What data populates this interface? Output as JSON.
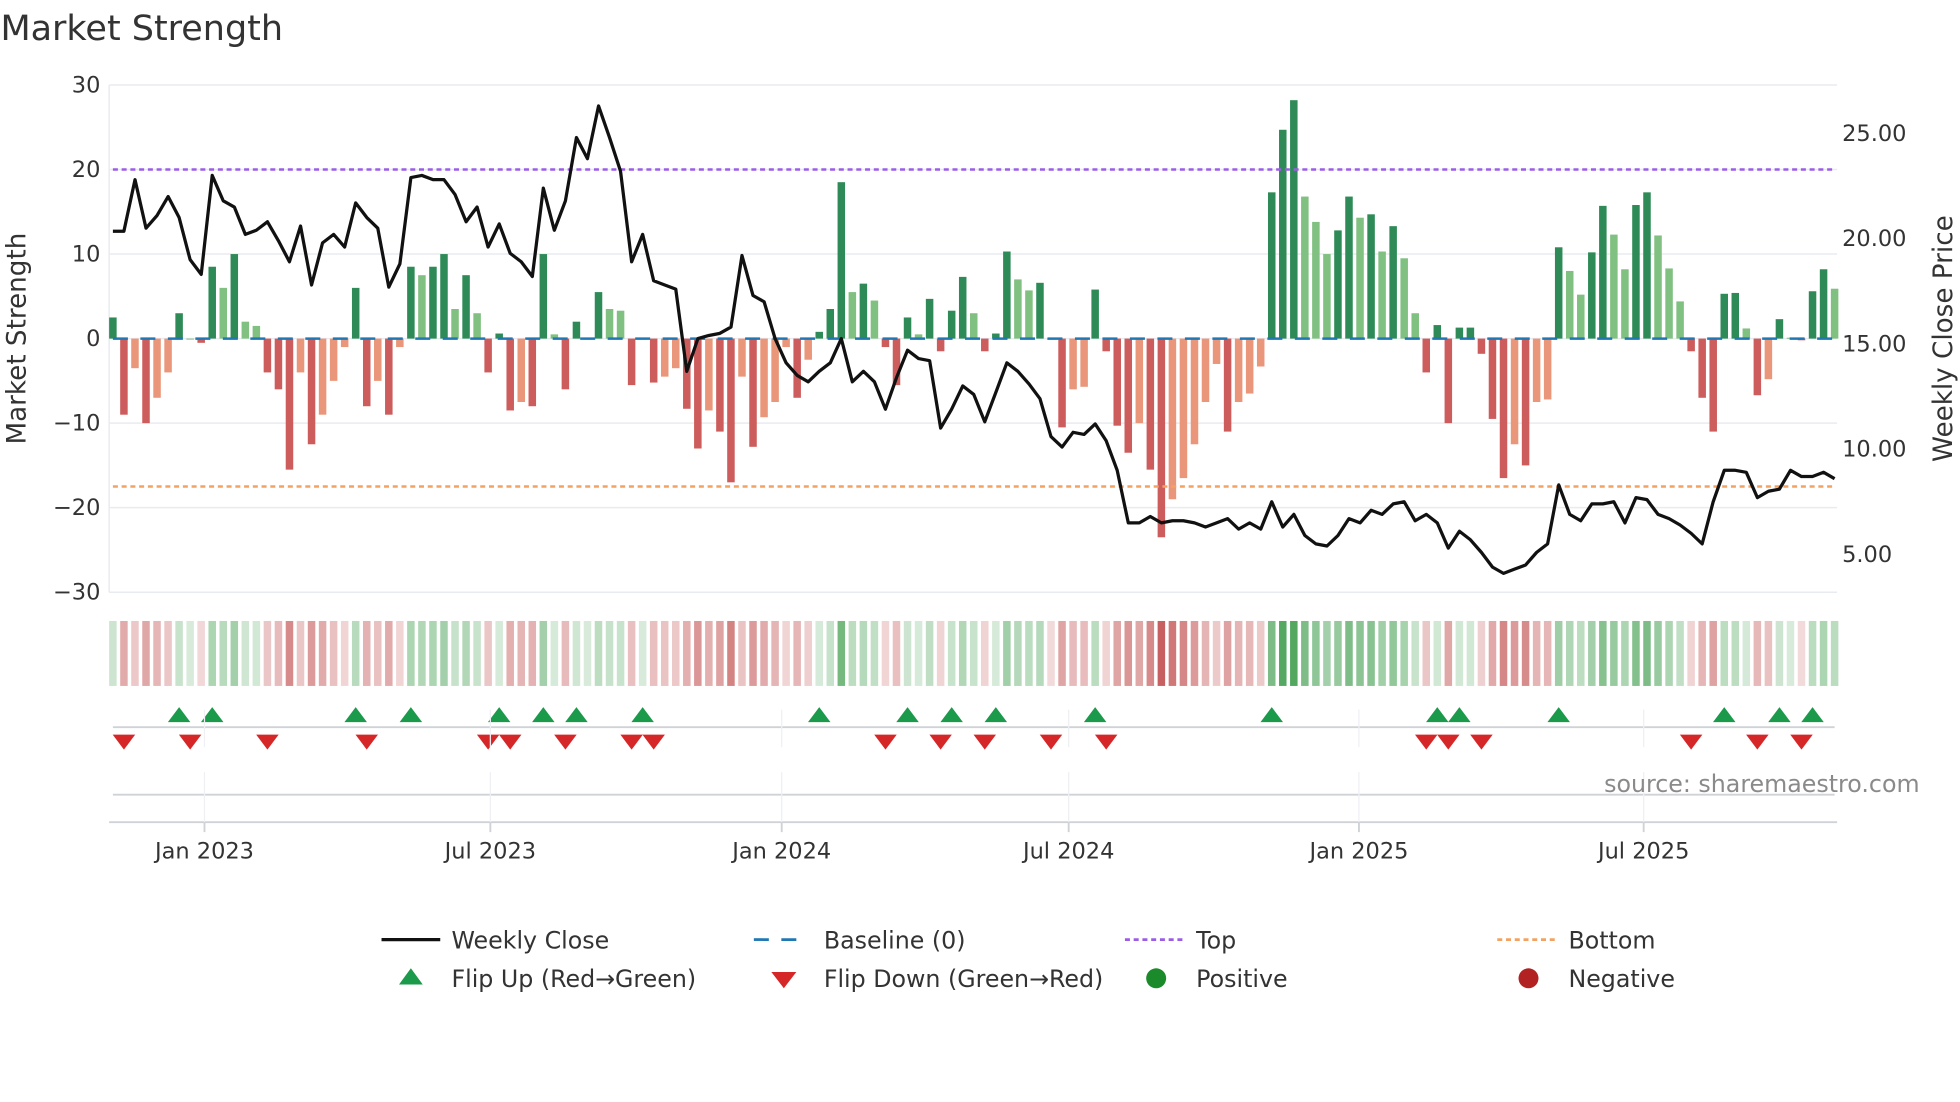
{
  "chart_data": {
    "type": "bar",
    "title": "Market Strength",
    "ylabel": "Market Strength",
    "y2label": "Weekly Close Price",
    "ylim": [
      -30,
      30
    ],
    "y2lim": [
      0,
      31.3
    ],
    "yticks": [
      "30",
      "20",
      "10",
      "0",
      "−10",
      "−20",
      "−30"
    ],
    "ytick_values": [
      30,
      20,
      10,
      0,
      -10,
      -20,
      -30
    ],
    "y2ticks": [
      "25.00",
      "20.00",
      "15.00",
      "10.00",
      "5.00"
    ],
    "y2tick_values": [
      25,
      20,
      15,
      10,
      5
    ],
    "xticks": [
      "Jan 2023",
      "Jul 2023",
      "Jan 2024",
      "Jul 2024",
      "Jan 2025",
      "Jul 2025"
    ],
    "xtick_week_index": [
      8.3,
      34.2,
      60.6,
      86.6,
      112.9,
      138.7
    ],
    "top_level": 20,
    "bottom_level": -17.5,
    "grid": true,
    "legend_placement": "bottom",
    "colors": {
      "strong_green": "#2e8b57",
      "weak_green": "#80c080",
      "strong_red": "#cd5c5c",
      "weak_red": "#e9967a",
      "baseline": "#1f77b4",
      "top": "#9b5de5",
      "bottom": "#f4a261",
      "close": "#111111",
      "flip_up": "#1a9a4a",
      "flip_down": "#d62728",
      "positive": "#1a8a2a",
      "negative": "#b22222"
    },
    "strength": [
      2.5,
      -9,
      -3.5,
      -10,
      -7,
      -4,
      3,
      0,
      -0.5,
      8.5,
      6,
      10,
      2,
      1.5,
      -4,
      -6,
      -15.5,
      -4,
      -12.5,
      -9,
      -5,
      -1,
      6,
      -8,
      -5,
      -9,
      -1,
      8.5,
      7.5,
      8.5,
      10,
      3.5,
      7.5,
      3,
      -4,
      0.6,
      -8.5,
      -7.5,
      -8,
      10,
      0.5,
      -6,
      2,
      0,
      5.5,
      3.5,
      3.3,
      -5.5,
      0,
      -5.2,
      -4.5,
      -3.5,
      -8.3,
      -13,
      -8.5,
      -11,
      -17,
      -4.5,
      -12.8,
      -9.3,
      -7.5,
      -1,
      -7,
      -2.5,
      0.8,
      3.5,
      18.5,
      5.5,
      6.5,
      4.5,
      -1,
      -5.5,
      2.5,
      0.5,
      4.7,
      -1.5,
      3.3,
      7.3,
      3,
      -1.5,
      0.6,
      10.3,
      7,
      5.7,
      6.6,
      -0.1,
      -10.5,
      -6,
      -5.7,
      5.8,
      -1.5,
      -10.3,
      -13.5,
      -10,
      -15.5,
      -23.5,
      -19,
      -16.5,
      -12.5,
      -7.5,
      -3,
      -11,
      -7.5,
      -6.5,
      -3.3,
      17.3,
      24.7,
      28.2,
      16.8,
      13.8,
      10,
      12.8,
      16.8,
      14.3,
      14.7,
      10.3,
      13.3,
      9.5,
      3,
      -4,
      1.6,
      -10,
      1.3,
      1.3,
      -1.8,
      -9.5,
      -16.5,
      -12.5,
      -15,
      -7.5,
      -7.2,
      10.8,
      8,
      5.2,
      10.2,
      15.7,
      12.3,
      8.2,
      15.8,
      17.3,
      12.2,
      8.3,
      4.4,
      -1.5,
      -7,
      -11,
      5.3,
      5.4,
      1.2,
      -6.7,
      -4.8,
      2.3,
      0.1,
      -0.2,
      5.6,
      8.2,
      5.9
    ],
    "weekly_close": [
      20.35,
      20.35,
      22.8,
      20.5,
      21.1,
      22.0,
      21.0,
      19.0,
      18.3,
      23.0,
      21.8,
      21.5,
      20.2,
      20.4,
      20.8,
      19.9,
      18.9,
      20.6,
      17.8,
      19.8,
      20.2,
      19.6,
      21.7,
      21.0,
      20.5,
      17.7,
      18.8,
      22.9,
      23.0,
      22.8,
      22.8,
      22.1,
      20.8,
      21.5,
      19.6,
      20.7,
      19.3,
      18.9,
      18.2,
      22.4,
      20.4,
      21.8,
      24.8,
      23.8,
      26.3,
      24.8,
      23.2,
      18.9,
      20.2,
      18.0,
      17.8,
      17.6,
      13.7,
      15.25,
      15.4,
      15.5,
      15.8,
      19.2,
      17.3,
      17.0,
      15.25,
      14.1,
      13.5,
      13.2,
      13.7,
      14.1,
      15.25,
      13.2,
      13.7,
      13.2,
      11.9,
      13.4,
      14.7,
      14.3,
      14.2,
      11.0,
      11.9,
      13.0,
      12.6,
      11.3,
      12.7,
      14.1,
      13.7,
      13.1,
      12.4,
      10.6,
      10.1,
      10.8,
      10.7,
      11.2,
      10.4,
      9.0,
      6.5,
      6.5,
      6.8,
      6.5,
      6.6,
      6.6,
      6.5,
      6.3,
      6.5,
      6.7,
      6.2,
      6.5,
      6.2,
      7.5,
      6.3,
      6.9,
      5.9,
      5.5,
      5.4,
      5.9,
      6.7,
      6.5,
      7.1,
      6.9,
      7.4,
      7.5,
      6.6,
      6.9,
      6.5,
      5.3,
      6.1,
      5.7,
      5.1,
      4.4,
      4.1,
      4.3,
      4.5,
      5.1,
      5.5,
      8.3,
      6.9,
      6.6,
      7.4,
      7.4,
      7.5,
      6.5,
      7.7,
      7.6,
      6.9,
      6.7,
      6.4,
      6.0,
      5.5,
      7.5,
      9.0,
      9.0,
      8.9,
      7.7,
      8.0,
      8.1,
      9.0,
      8.7,
      8.7,
      8.9,
      8.6
    ],
    "flip_up_week_index": [
      6,
      9,
      22,
      27,
      35,
      39,
      42,
      48,
      64,
      72,
      76,
      80,
      89,
      105,
      120,
      122,
      131,
      146,
      151,
      154
    ],
    "flip_down_week_index": [
      1,
      7,
      14,
      23,
      34,
      36,
      41,
      47,
      49,
      70,
      75,
      79,
      85,
      90,
      119,
      121,
      124,
      143,
      149,
      153
    ],
    "legend": {
      "weekly_close": "Weekly Close",
      "baseline": "Baseline (0)",
      "top": "Top",
      "bottom": "Bottom",
      "flip_up": "Flip Up (Red→Green)",
      "flip_down": "Flip Down (Green→Red)",
      "positive": "Positive",
      "negative": "Negative"
    },
    "source": "source: sharemaestro.com"
  }
}
